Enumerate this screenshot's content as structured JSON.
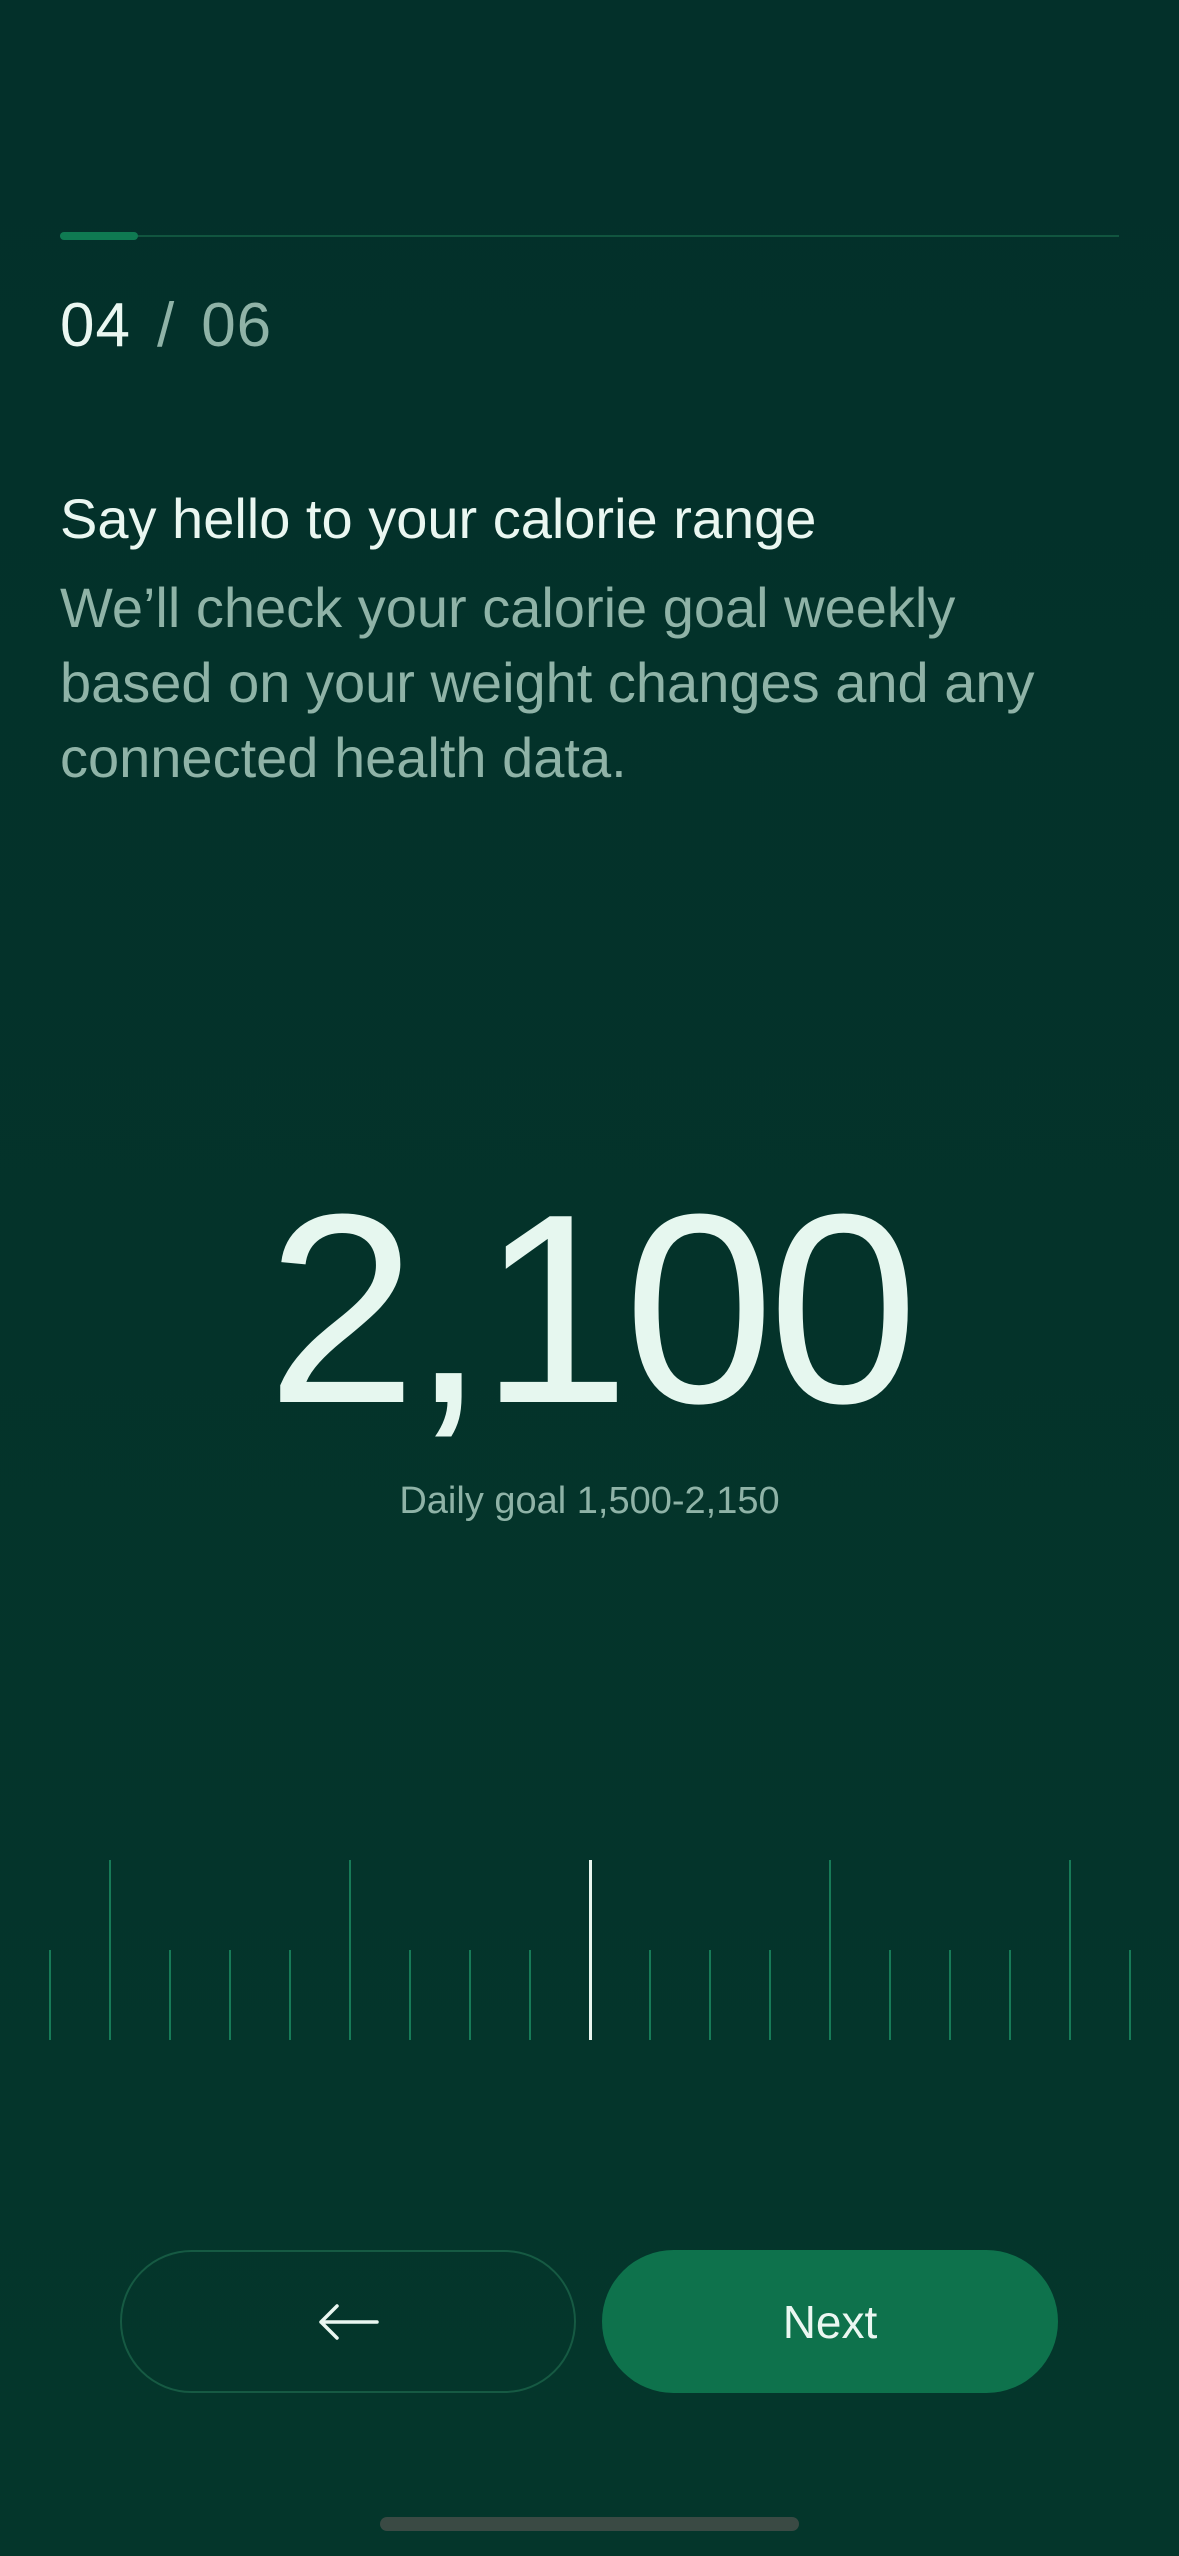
{
  "progress": {
    "current": "04",
    "separator": "/",
    "total": "06",
    "fraction": 0.0733
  },
  "content": {
    "title": "Say hello to your calorie range",
    "description": "We’ll check your calorie goal weekly based on your weight changes and any connected health data."
  },
  "calories": {
    "value": "2,100",
    "range_label": "Daily goal 1,500-2,150"
  },
  "actions": {
    "back_icon": "arrow-left-icon",
    "next_label": "Next"
  },
  "colors": {
    "background": "#04332a",
    "accent": "#0e724c",
    "text_primary": "#eaf7f1",
    "text_secondary": "#8fb3a7"
  }
}
